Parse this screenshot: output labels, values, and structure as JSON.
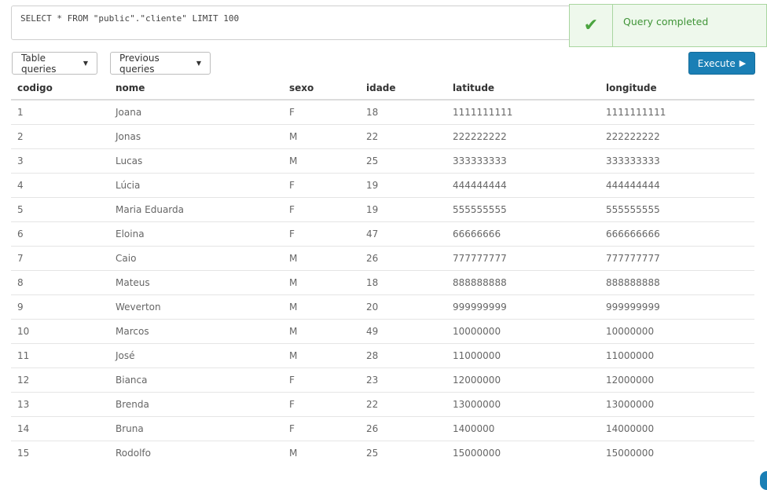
{
  "query": {
    "text": "SELECT * FROM \"public\".\"cliente\" LIMIT 100"
  },
  "toast": {
    "message": "Query completed",
    "icon": "check-icon",
    "color": "#4aa43f"
  },
  "toolbar": {
    "table_queries_label": "Table queries",
    "previous_queries_label": "Previous queries",
    "execute_label": "Execute",
    "execute_color": "#1a7fb5"
  },
  "table": {
    "columns": [
      "codigo",
      "nome",
      "sexo",
      "idade",
      "latitude",
      "longitude"
    ],
    "rows": [
      [
        "1",
        "Joana",
        "F",
        "18",
        "1111111111",
        "1111111111"
      ],
      [
        "2",
        "Jonas",
        "M",
        "22",
        "222222222",
        "222222222"
      ],
      [
        "3",
        "Lucas",
        "M",
        "25",
        "333333333",
        "333333333"
      ],
      [
        "4",
        "Lúcia",
        "F",
        "19",
        "444444444",
        "444444444"
      ],
      [
        "5",
        "Maria Eduarda",
        "F",
        "19",
        "555555555",
        "555555555"
      ],
      [
        "6",
        "Eloina",
        "F",
        "47",
        "66666666",
        "666666666"
      ],
      [
        "7",
        "Caio",
        "M",
        "26",
        "777777777",
        "777777777"
      ],
      [
        "8",
        "Mateus",
        "M",
        "18",
        "888888888",
        "888888888"
      ],
      [
        "9",
        "Weverton",
        "M",
        "20",
        "999999999",
        "999999999"
      ],
      [
        "10",
        "Marcos",
        "M",
        "49",
        "10000000",
        "10000000"
      ],
      [
        "11",
        "José",
        "M",
        "28",
        "11000000",
        "11000000"
      ],
      [
        "12",
        "Bianca",
        "F",
        "23",
        "12000000",
        "12000000"
      ],
      [
        "13",
        "Brenda",
        "F",
        "22",
        "13000000",
        "13000000"
      ],
      [
        "14",
        "Bruna",
        "F",
        "26",
        "1400000",
        "14000000"
      ],
      [
        "15",
        "Rodolfo",
        "M",
        "25",
        "15000000",
        "15000000"
      ]
    ]
  }
}
